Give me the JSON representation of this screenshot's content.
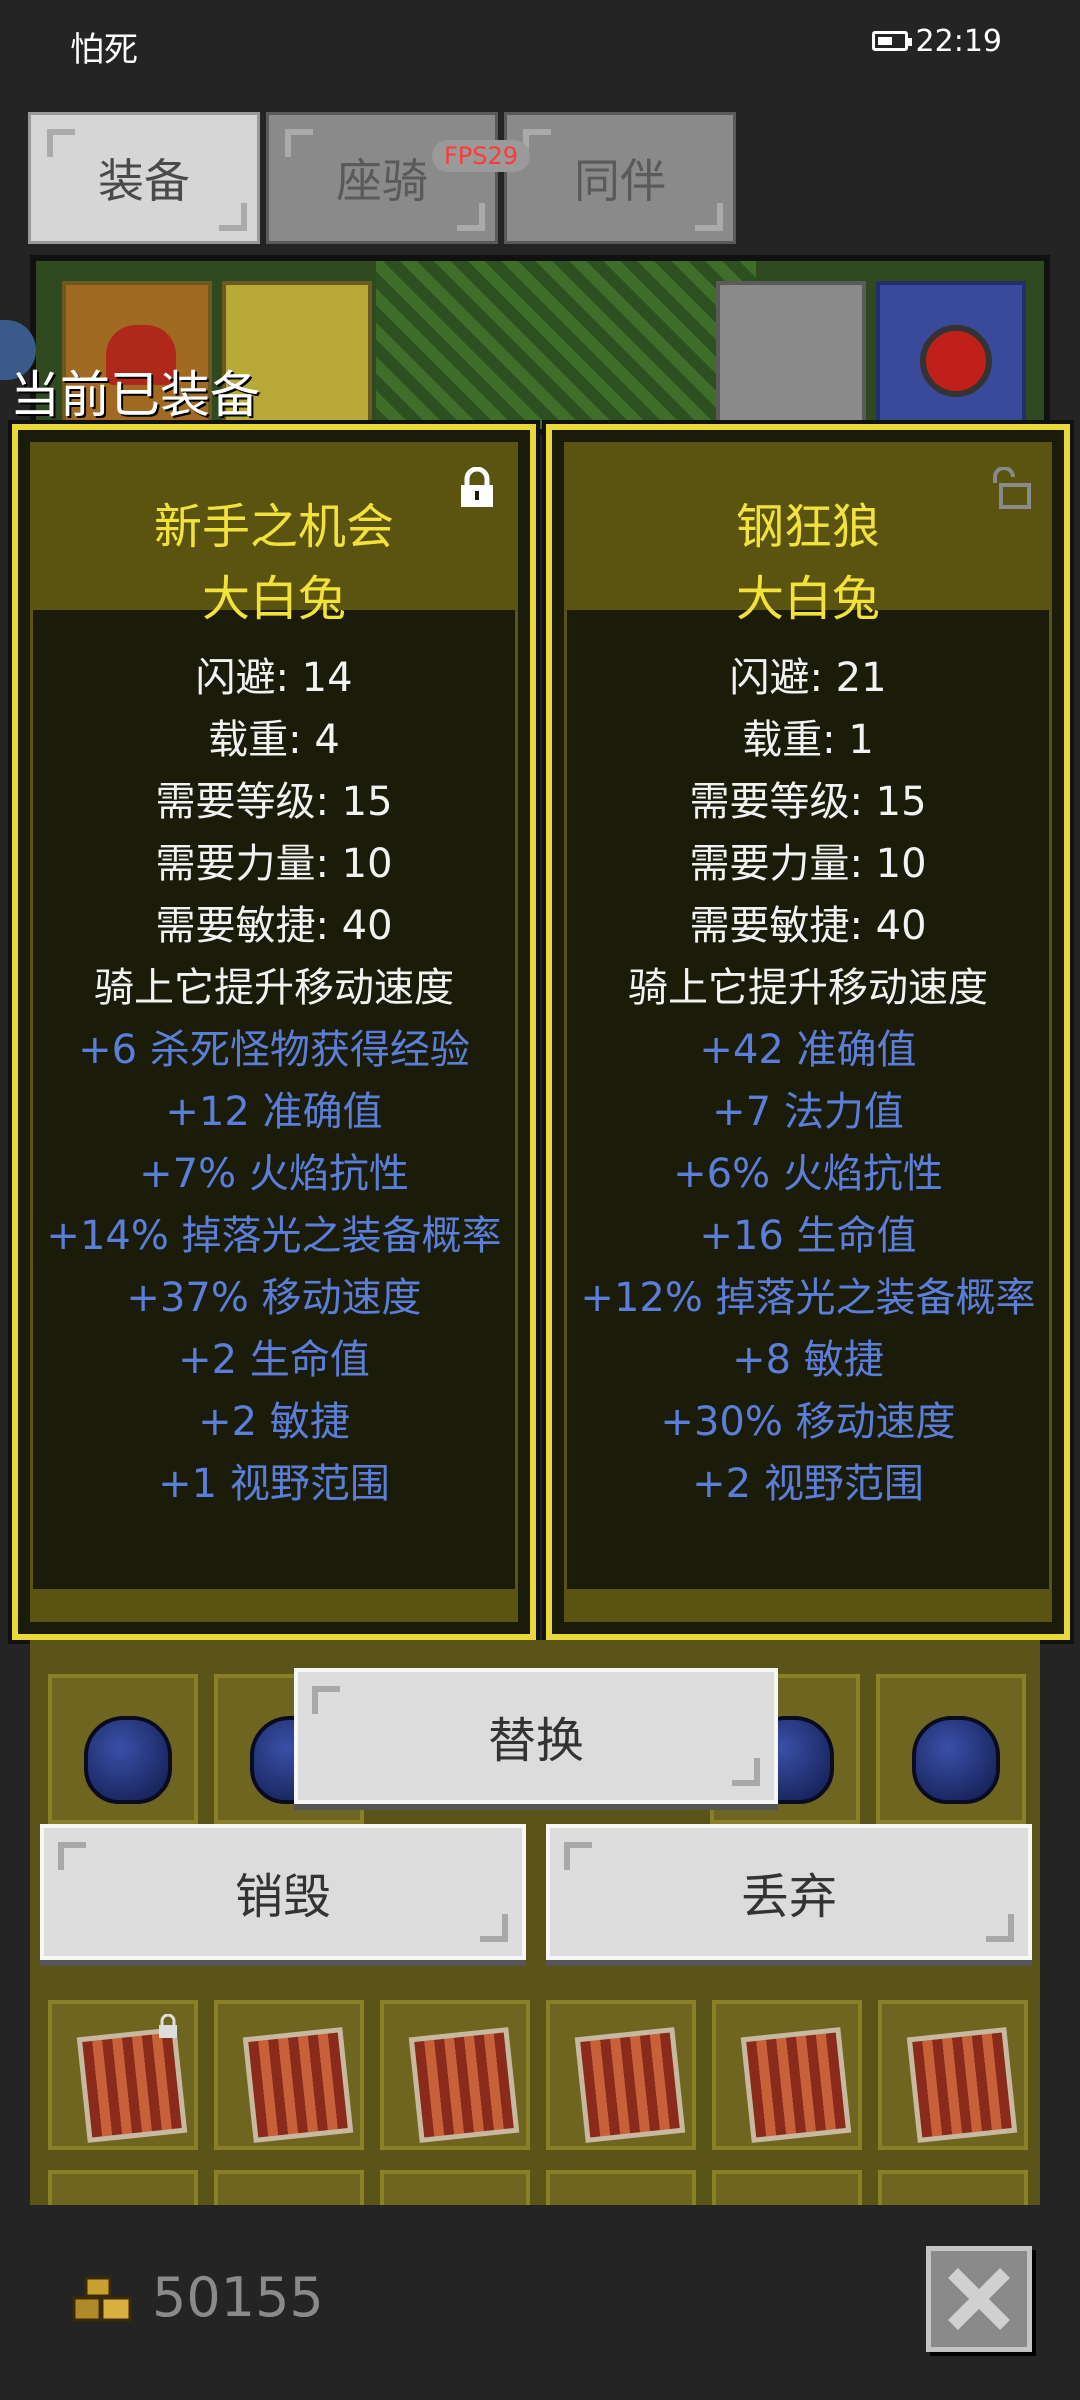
{
  "status_bar": {
    "title": "怕死",
    "time": "22:19"
  },
  "tabs": [
    {
      "label": "装备",
      "active": true
    },
    {
      "label": "座骑",
      "active": false
    },
    {
      "label": "同伴",
      "active": false
    }
  ],
  "fps_badge": "FPS29",
  "equipped_label": "当前已装备",
  "cards": [
    {
      "name_line1": "新手之机会",
      "name_line2": "大白兔",
      "locked": true,
      "base_stats": [
        "闪避: 14",
        "载重: 4",
        "需要等级: 15",
        "需要力量: 10",
        "需要敏捷: 40",
        "骑上它提升移动速度"
      ],
      "bonus_stats": [
        "+6 杀死怪物获得经验",
        "+12 准确值",
        "+7% 火焰抗性",
        "+14% 掉落光之装备概率",
        "+37% 移动速度",
        "+2 生命值",
        "+2 敏捷",
        "+1 视野范围"
      ]
    },
    {
      "name_line1": "钢狂狼",
      "name_line2": "大白兔",
      "locked": false,
      "base_stats": [
        "闪避: 21",
        "载重: 1",
        "需要等级: 15",
        "需要力量: 10",
        "需要敏捷: 40",
        "骑上它提升移动速度"
      ],
      "bonus_stats": [
        "+42 准确值",
        "+7 法力值",
        "+6% 火焰抗性",
        "+16 生命值",
        "+12% 掉落光之装备概率",
        "+8 敏捷",
        "+30% 移动速度",
        "+2 视野范围"
      ]
    }
  ],
  "actions": {
    "replace": "替换",
    "destroy": "销毁",
    "discard": "丢弃"
  },
  "gold": "50155",
  "colors": {
    "card_border": "#e8d838",
    "name": "#f2e23a",
    "bonus_stat": "#5b7fd8",
    "base_stat": "#f2f2f2"
  },
  "icons": {
    "lock": "lock-icon",
    "unlock": "unlock-icon",
    "gold": "gold-coins-icon",
    "close": "close-icon"
  }
}
